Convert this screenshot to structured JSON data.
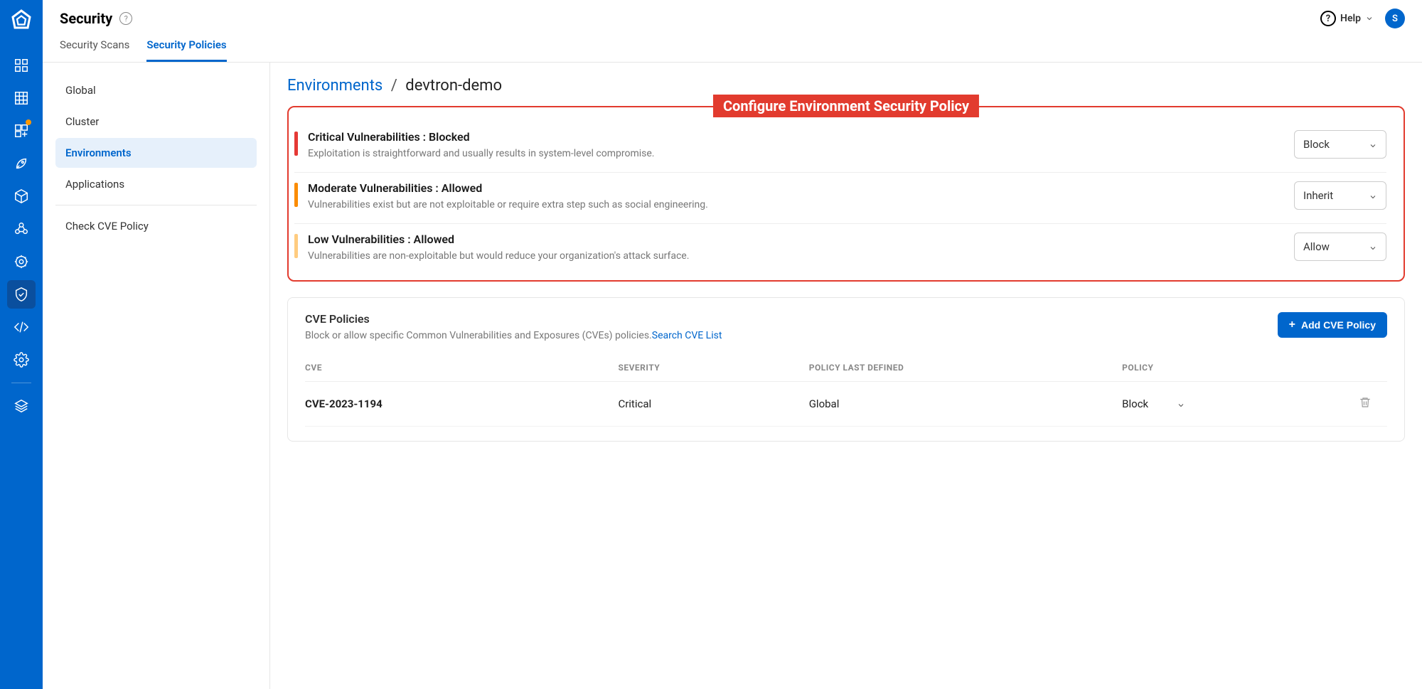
{
  "header": {
    "title": "Security",
    "help_label": "Help",
    "avatar_initial": "S"
  },
  "tabs": [
    {
      "label": "Security Scans",
      "active": false
    },
    {
      "label": "Security Policies",
      "active": true
    }
  ],
  "sidebar": {
    "items": [
      {
        "label": "Global",
        "active": false
      },
      {
        "label": "Cluster",
        "active": false
      },
      {
        "label": "Environments",
        "active": true
      },
      {
        "label": "Applications",
        "active": false
      }
    ],
    "cve_item": {
      "label": "Check CVE Policy"
    }
  },
  "breadcrumb": {
    "parent": "Environments",
    "sep": "/",
    "current": "devtron-demo"
  },
  "callout_label": "Configure Environment Security Policy",
  "vulnerabilities": [
    {
      "severity": "critical",
      "title": "Critical Vulnerabilities : Blocked",
      "desc": "Exploitation is straightforward and usually results in system-level compromise.",
      "action": "Block"
    },
    {
      "severity": "moderate",
      "title": "Moderate Vulnerabilities : Allowed",
      "desc": "Vulnerabilities exist but are not exploitable or require extra step such as social engineering.",
      "action": "Inherit"
    },
    {
      "severity": "low",
      "title": "Low Vulnerabilities : Allowed",
      "desc": "Vulnerabilities are non-exploitable but would reduce your organization's attack surface.",
      "action": "Allow"
    }
  ],
  "cve_card": {
    "title": "CVE Policies",
    "subtitle": "Block or allow specific Common Vulnerabilities and Exposures (CVEs) policies.",
    "search_link": "Search CVE List",
    "add_btn": "Add CVE Policy",
    "columns": {
      "cve": "CVE",
      "severity": "SEVERITY",
      "last_defined": "POLICY LAST DEFINED",
      "policy": "POLICY"
    },
    "rows": [
      {
        "cve": "CVE-2023-1194",
        "severity": "Critical",
        "last_defined": "Global",
        "policy": "Block"
      }
    ]
  }
}
